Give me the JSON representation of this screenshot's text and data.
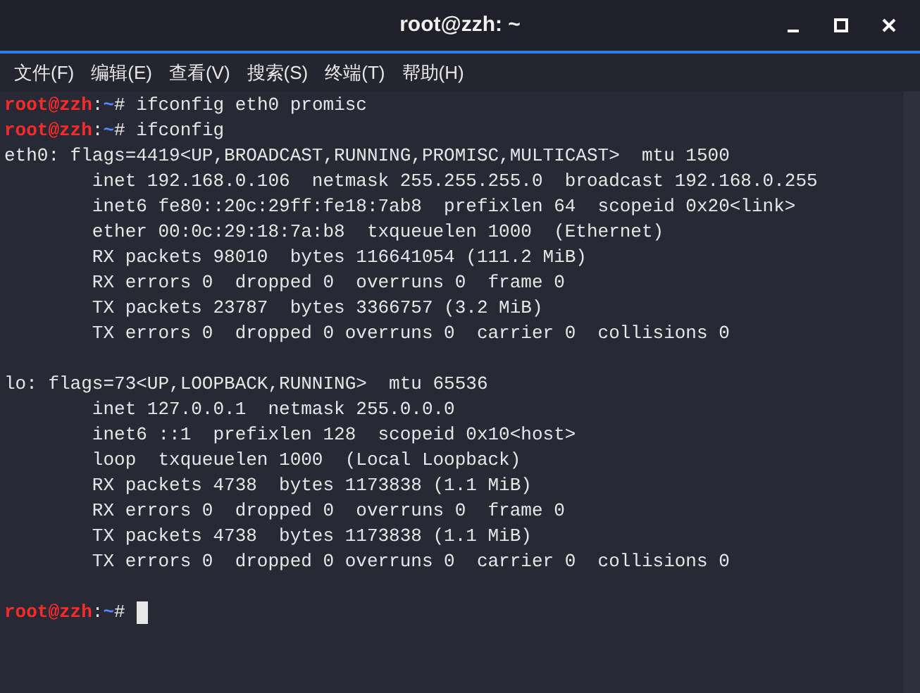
{
  "window": {
    "title": "root@zzh: ~"
  },
  "menu": [
    "文件(F)",
    "编辑(E)",
    "查看(V)",
    "搜索(S)",
    "终端(T)",
    "帮助(H)"
  ],
  "terminal": {
    "lines": [
      {
        "kind": "prompt",
        "user": "root@zzh",
        "separator": ":",
        "path": "~",
        "symbol": "#",
        "command": "ifconfig eth0 promisc",
        "cursor": false
      },
      {
        "kind": "prompt",
        "user": "root@zzh",
        "separator": ":",
        "path": "~",
        "symbol": "#",
        "command": "ifconfig",
        "cursor": false
      },
      {
        "kind": "output",
        "text": "eth0: flags=4419<UP,BROADCAST,RUNNING,PROMISC,MULTICAST>  mtu 1500"
      },
      {
        "kind": "output",
        "text": "        inet 192.168.0.106  netmask 255.255.255.0  broadcast 192.168.0.255"
      },
      {
        "kind": "output",
        "text": "        inet6 fe80::20c:29ff:fe18:7ab8  prefixlen 64  scopeid 0x20<link>"
      },
      {
        "kind": "output",
        "text": "        ether 00:0c:29:18:7a:b8  txqueuelen 1000  (Ethernet)"
      },
      {
        "kind": "output",
        "text": "        RX packets 98010  bytes 116641054 (111.2 MiB)"
      },
      {
        "kind": "output",
        "text": "        RX errors 0  dropped 0  overruns 0  frame 0"
      },
      {
        "kind": "output",
        "text": "        TX packets 23787  bytes 3366757 (3.2 MiB)"
      },
      {
        "kind": "output",
        "text": "        TX errors 0  dropped 0 overruns 0  carrier 0  collisions 0"
      },
      {
        "kind": "blank"
      },
      {
        "kind": "output",
        "text": "lo: flags=73<UP,LOOPBACK,RUNNING>  mtu 65536"
      },
      {
        "kind": "output",
        "text": "        inet 127.0.0.1  netmask 255.0.0.0"
      },
      {
        "kind": "output",
        "text": "        inet6 ::1  prefixlen 128  scopeid 0x10<host>"
      },
      {
        "kind": "output",
        "text": "        loop  txqueuelen 1000  (Local Loopback)"
      },
      {
        "kind": "output",
        "text": "        RX packets 4738  bytes 1173838 (1.1 MiB)"
      },
      {
        "kind": "output",
        "text": "        RX errors 0  dropped 0  overruns 0  frame 0"
      },
      {
        "kind": "output",
        "text": "        TX packets 4738  bytes 1173838 (1.1 MiB)"
      },
      {
        "kind": "output",
        "text": "        TX errors 0  dropped 0 overruns 0  carrier 0  collisions 0"
      },
      {
        "kind": "blank"
      },
      {
        "kind": "prompt",
        "user": "root@zzh",
        "separator": ":",
        "path": "~",
        "symbol": "#",
        "cursor": true
      }
    ]
  }
}
